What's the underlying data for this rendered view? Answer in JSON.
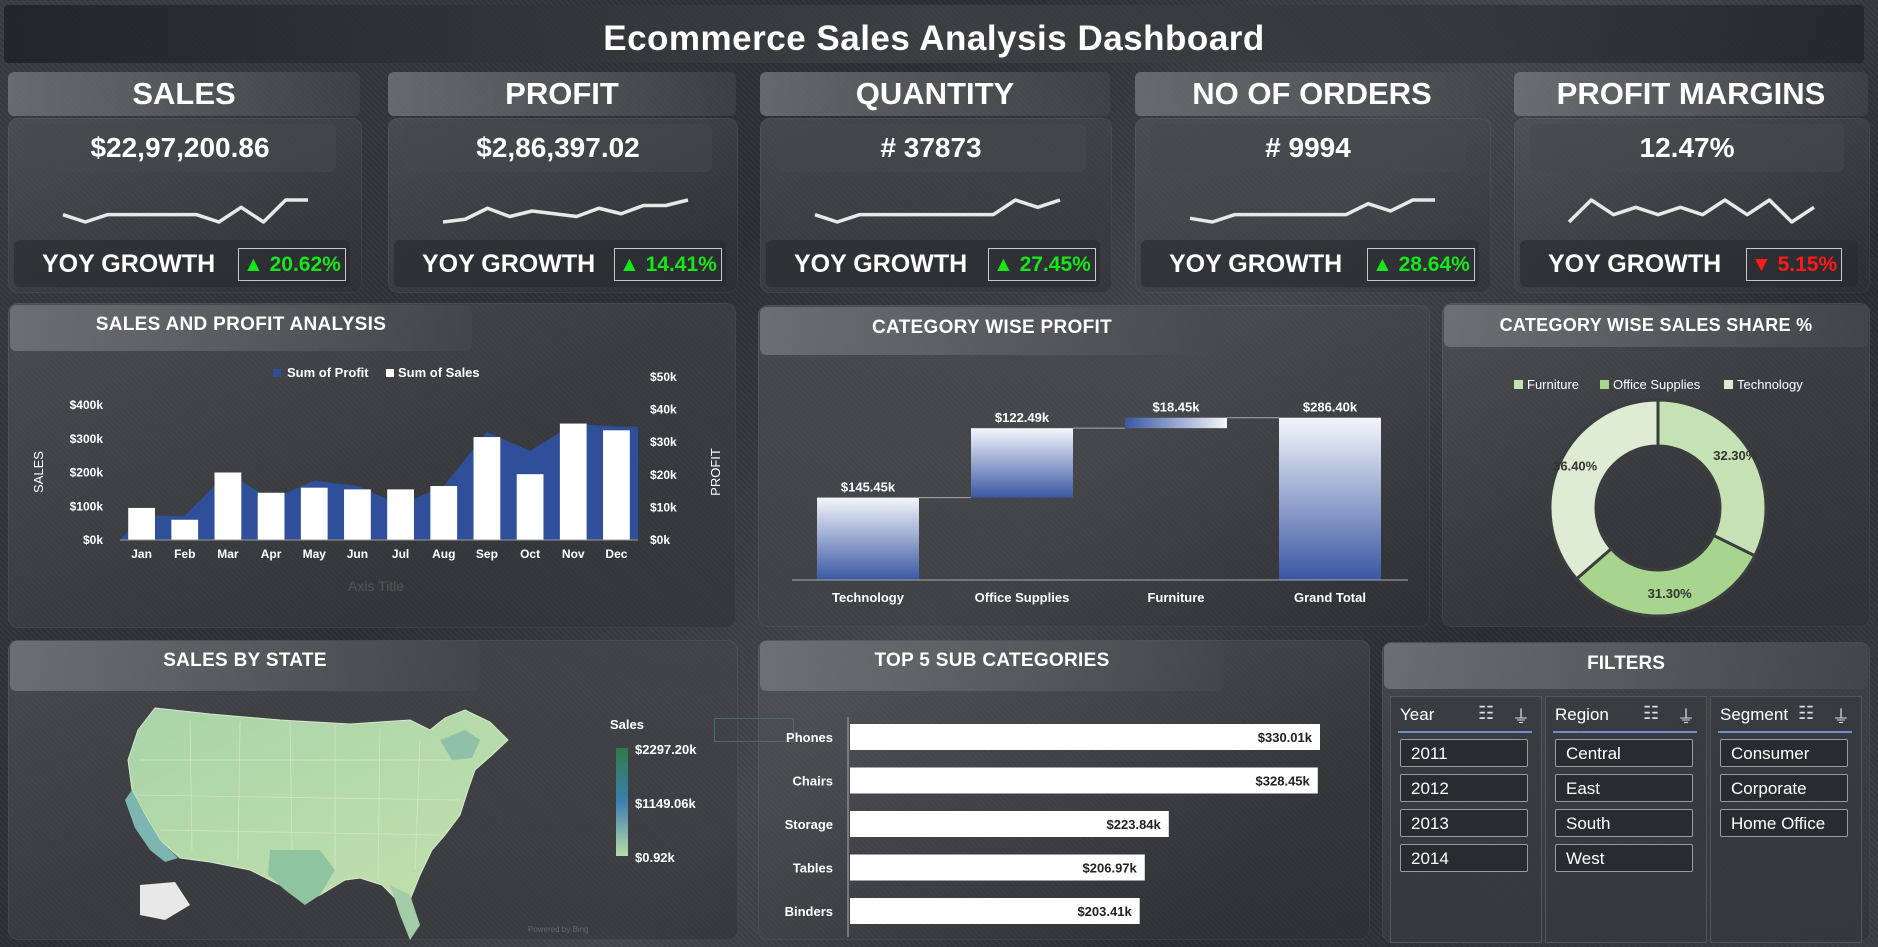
{
  "dashboard": {
    "title": "Ecommerce Sales Analysis Dashboard"
  },
  "kpis": [
    {
      "label": "SALES",
      "value": "$22,97,200.86",
      "yoy_label": "YOY GROWTH",
      "growth": "▲ 20.62%",
      "direction": "up",
      "spark": [
        3,
        2,
        3,
        3,
        3,
        3,
        3,
        2,
        4,
        2,
        5,
        5
      ]
    },
    {
      "label": "PROFIT",
      "value": "$2,86,397.02",
      "yoy_label": "YOY GROWTH",
      "growth": "▲ 14.41%",
      "direction": "up",
      "spark": [
        1,
        2,
        6,
        3,
        5,
        4,
        3,
        6,
        4,
        7,
        7,
        9
      ]
    },
    {
      "label": "QUANTITY",
      "value": "# 37873",
      "yoy_label": "YOY GROWTH",
      "growth": "▲ 27.45%",
      "direction": "up",
      "spark": [
        3,
        2,
        3,
        3,
        3,
        3,
        3,
        3,
        3,
        5,
        4,
        5
      ]
    },
    {
      "label": "NO OF ORDERS",
      "value": "# 9994",
      "yoy_label": "YOY GROWTH",
      "growth": "▲ 28.64%",
      "direction": "up",
      "spark": [
        2,
        1,
        3,
        3,
        3,
        3,
        3,
        3,
        6,
        4,
        7,
        7
      ]
    },
    {
      "label": "PROFIT MARGINS",
      "value": "12.47%",
      "yoy_label": "YOY GROWTH",
      "growth": "▼ 5.15%",
      "direction": "down",
      "spark": [
        3,
        6,
        4,
        5,
        4,
        5,
        4,
        6,
        4,
        6,
        3,
        5
      ]
    }
  ],
  "sales_profit": {
    "title": "SALES AND PROFIT ANALYSIS",
    "legend_profit": "Sum of Profit",
    "legend_sales": "Sum of Sales",
    "ylabel_left": "SALES",
    "ylabel_right": "PROFIT",
    "xlabel": "Axis Title",
    "left_ticks": [
      "$400k",
      "$300k",
      "$200k",
      "$100k",
      "$0k"
    ],
    "right_ticks": [
      "$50k",
      "$40k",
      "$30k",
      "$20k",
      "$10k",
      "$0k"
    ],
    "colors": {
      "profit": "#2f4f9a",
      "sales": "#ffffff"
    }
  },
  "category_profit": {
    "title": "CATEGORY WISE PROFIT",
    "labels": [
      "$145.45k",
      "$122.49k",
      "$18.45k",
      "$286.40k"
    ]
  },
  "category_share": {
    "title": "CATEGORY WISE SALES SHARE %",
    "legend": [
      "Furniture",
      "Office Supplies",
      "Technology"
    ],
    "labels": [
      "32.30%",
      "31.30%",
      "36.40%"
    ],
    "colors": [
      "#c5e2b4",
      "#a8d58e",
      "#deecd3"
    ]
  },
  "sales_by_state": {
    "title": "SALES BY STATE",
    "legend_title": "Sales",
    "legend_max": "$2297.20k",
    "legend_mid": "$1149.06k",
    "legend_min": "$0.92k",
    "watermark": "Powered by Bing"
  },
  "top_subcategories": {
    "title": "TOP 5 SUB CATEGORIES"
  },
  "filters": {
    "title": "FILTERS",
    "year": {
      "label": "Year",
      "items": [
        "2011",
        "2012",
        "2013",
        "2014"
      ]
    },
    "region": {
      "label": "Region",
      "items": [
        "Central",
        "East",
        "South",
        "West"
      ]
    },
    "segment": {
      "label": "Segment",
      "items": [
        "Consumer",
        "Corporate",
        "Home Office"
      ]
    }
  },
  "chart_data": [
    {
      "type": "bar",
      "title": "SALES AND PROFIT ANALYSIS",
      "categories": [
        "Jan",
        "Feb",
        "Mar",
        "Apr",
        "May",
        "Jun",
        "Jul",
        "Aug",
        "Sep",
        "Oct",
        "Nov",
        "Dec"
      ],
      "series": [
        {
          "name": "Sum of Sales",
          "values": [
            95000,
            60000,
            200000,
            140000,
            155000,
            150000,
            150000,
            160000,
            305000,
            195000,
            345000,
            325000
          ],
          "axis": "left",
          "kind": "bar"
        },
        {
          "name": "Sum of Profit",
          "values": [
            9000,
            9000,
            25000,
            15000,
            22000,
            20000,
            13000,
            20000,
            40000,
            33000,
            43000,
            42000
          ],
          "axis": "right",
          "kind": "area"
        }
      ],
      "ylabel": "SALES",
      "y2label": "PROFIT",
      "xlabel": "Axis Title",
      "ylim": [
        0,
        400000
      ],
      "y2lim": [
        0,
        50000
      ],
      "legend": "top"
    },
    {
      "type": "bar",
      "title": "CATEGORY WISE PROFIT",
      "categories": [
        "Technology",
        "Office Supplies",
        "Furniture",
        "Grand Total"
      ],
      "values": [
        145450,
        122490,
        18450,
        286400
      ],
      "subtype": "waterfall"
    },
    {
      "type": "pie",
      "title": "CATEGORY WISE SALES SHARE %",
      "categories": [
        "Furniture",
        "Office Supplies",
        "Technology"
      ],
      "values": [
        32.3,
        31.3,
        36.4
      ],
      "legend": "top"
    },
    {
      "type": "bar",
      "title": "TOP 5 SUB CATEGORIES",
      "categories": [
        "Phones",
        "Chairs",
        "Storage",
        "Tables",
        "Binders"
      ],
      "values": [
        330010,
        328450,
        223840,
        206970,
        203410
      ],
      "orientation": "horizontal",
      "value_labels": [
        "$330.01k",
        "$328.45k",
        "$223.84k",
        "$206.97k",
        "$203.41k"
      ]
    }
  ]
}
